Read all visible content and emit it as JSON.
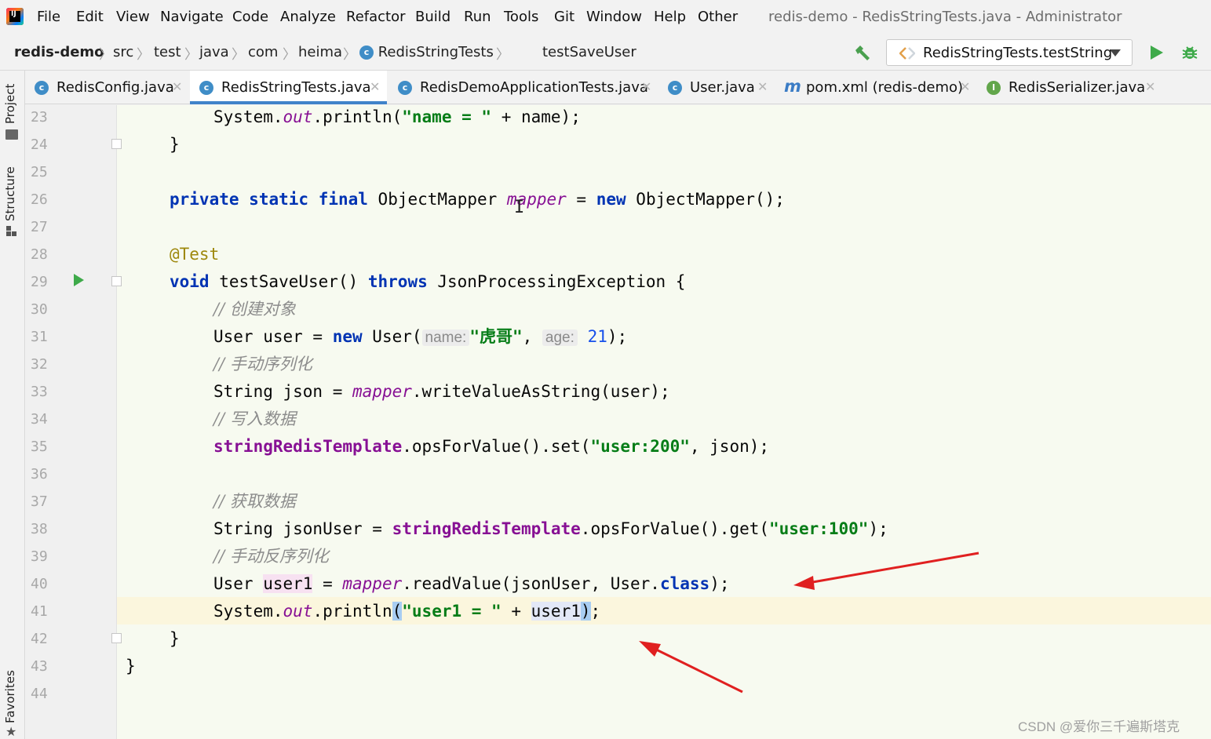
{
  "app": {
    "window_title": "redis-demo - RedisStringTests.java - Administrator"
  },
  "menu": [
    {
      "id": "file",
      "label": "File"
    },
    {
      "id": "edit",
      "label": "Edit"
    },
    {
      "id": "view",
      "label": "View"
    },
    {
      "id": "navigate",
      "label": "Navigate"
    },
    {
      "id": "code",
      "label": "Code"
    },
    {
      "id": "analyze",
      "label": "Analyze"
    },
    {
      "id": "refactor",
      "label": "Refactor"
    },
    {
      "id": "build",
      "label": "Build"
    },
    {
      "id": "run",
      "label": "Run"
    },
    {
      "id": "tools",
      "label": "Tools"
    },
    {
      "id": "git",
      "label": "Git"
    },
    {
      "id": "window",
      "label": "Window"
    },
    {
      "id": "help",
      "label": "Help"
    },
    {
      "id": "other",
      "label": "Other"
    }
  ],
  "breadcrumb": {
    "project": "redis-demo",
    "parts": [
      "src",
      "test",
      "java",
      "com",
      "heima"
    ],
    "class_name": "RedisStringTests",
    "method": "testSaveUser"
  },
  "run_config": {
    "label": "RedisStringTests.testString",
    "build_icon": "hammer-icon",
    "run_icon": "run-icon",
    "debug_icon": "debug-icon"
  },
  "tabs": [
    {
      "label": "RedisConfig.java",
      "icon": "class-icon",
      "active": false
    },
    {
      "label": "RedisStringTests.java",
      "icon": "class-icon",
      "active": true
    },
    {
      "label": "RedisDemoApplicationTests.java",
      "icon": "class-icon",
      "active": false
    },
    {
      "label": "User.java",
      "icon": "class-icon",
      "active": false
    },
    {
      "label": "pom.xml (redis-demo)",
      "icon": "maven-icon",
      "active": false
    },
    {
      "label": "RedisSerializer.java",
      "icon": "interface-icon",
      "active": false
    }
  ],
  "tool_windows": {
    "project": "Project",
    "structure": "Structure",
    "favorites": "Favorites"
  },
  "editor": {
    "line_numbers": [
      "23",
      "24",
      "25",
      "26",
      "27",
      "28",
      "29",
      "30",
      "31",
      "32",
      "33",
      "34",
      "35",
      "36",
      "37",
      "38",
      "39",
      "40",
      "41",
      "42",
      "43",
      "44"
    ],
    "current_line": "41",
    "code": {
      "l23": {
        "a": "System.",
        "b": "out",
        "c": ".println(",
        "d": "\"name = \"",
        "e": " + name);"
      },
      "l24": "}",
      "l26": {
        "a": "private",
        "b": "static",
        "c": "final",
        "d": " ObjectMapper ",
        "e": "mapper",
        "f": " = ",
        "g": "new",
        "h": " ObjectMapper();"
      },
      "l28": "@Test",
      "l29": {
        "a": "void",
        "b": " testSaveUser() ",
        "c": "throws",
        "d": " JsonProcessingException {"
      },
      "l30": "// 创建对象",
      "l31": {
        "a": "User user = ",
        "b": "new",
        "c": " User(",
        "hint1": "name:",
        "d": "\"虎哥\"",
        "e": ", ",
        "hint2": "age:",
        "f": "21",
        "g": ");"
      },
      "l32": "// 手动序列化",
      "l33": {
        "a": "String json = ",
        "b": "mapper",
        "c": ".writeValueAsString(user);"
      },
      "l34": "// 写入数据",
      "l35": {
        "a": "stringRedisTemplate",
        "b": ".opsForValue().set(",
        "c": "\"user:200\"",
        "d": ", json);"
      },
      "l37": "// 获取数据",
      "l38": {
        "a": "String jsonUser = ",
        "b": "stringRedisTemplate",
        "c": ".opsForValue().get(",
        "d": "\"user:100\"",
        "e": ");"
      },
      "l39": "// 手动反序列化",
      "l40": {
        "a": "User ",
        "b": "user1",
        "c": " = ",
        "d": "mapper",
        "e": ".readValue(jsonUser, User.",
        "f": "class",
        "g": ");"
      },
      "l41": {
        "a": "System.",
        "b": "out",
        "c": ".println",
        "d": "(",
        "e": "\"user1 = \"",
        "f": " + ",
        "g": "user1",
        "h": ")",
        "i": ";"
      },
      "l42": "}",
      "l43": "}"
    }
  },
  "watermark": "CSDN @爱你三千遍斯塔克",
  "colors": {
    "keyword": "#0033b3",
    "string": "#067d17",
    "field": "#871094",
    "annotation": "#9e880d",
    "comment": "#8c8c8c",
    "number": "#1750eb",
    "arrow": "#e02020",
    "tab_underline": "#4083c9"
  }
}
